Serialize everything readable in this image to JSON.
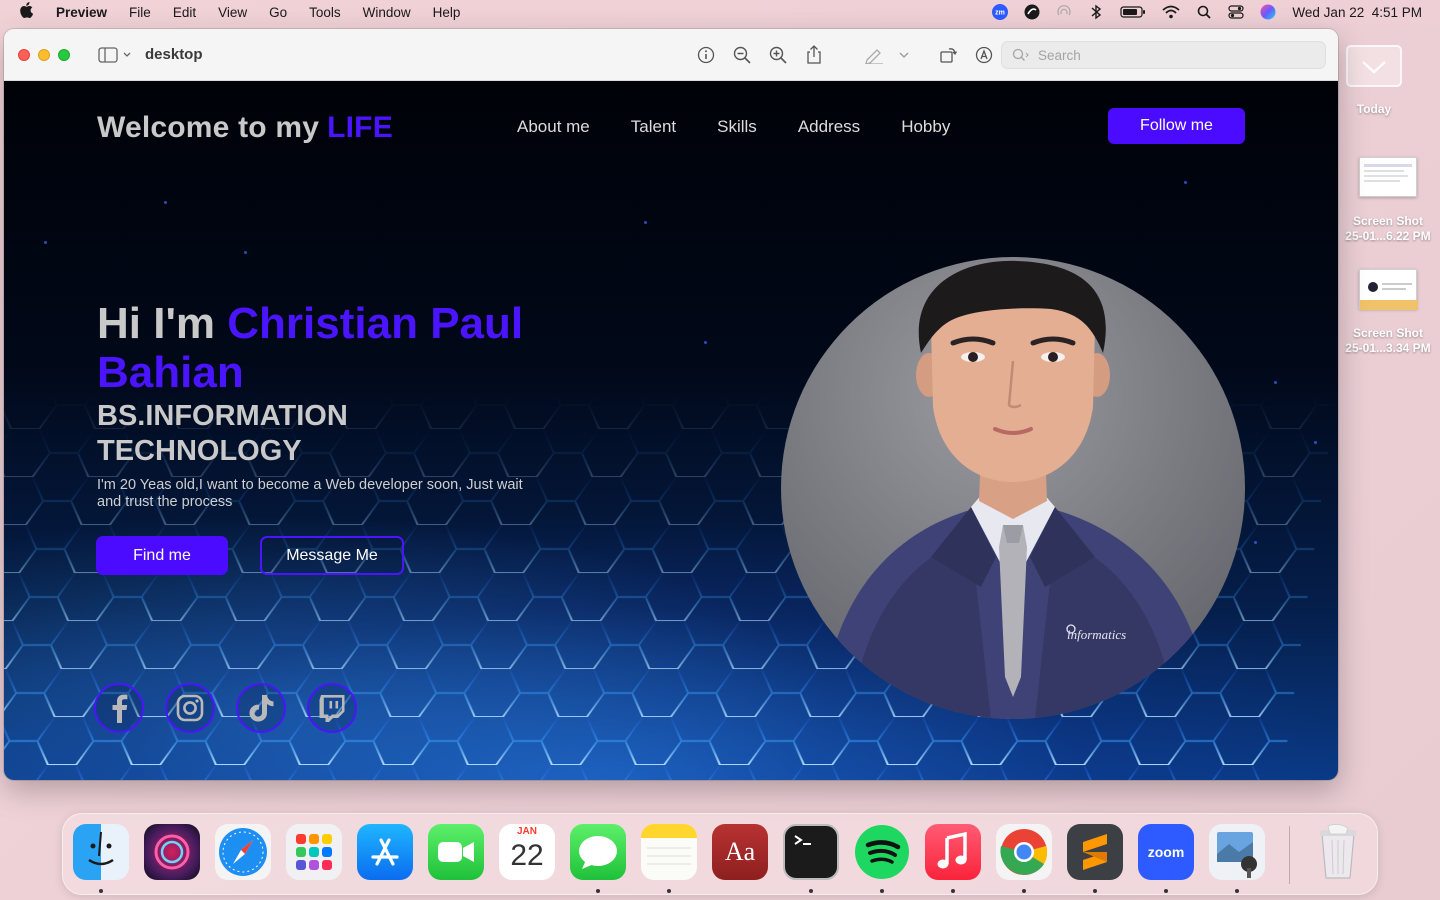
{
  "menubar": {
    "app_name": "Preview",
    "items": [
      "File",
      "Edit",
      "View",
      "Go",
      "Tools",
      "Window",
      "Help"
    ],
    "status_icons": [
      "zoom-icon",
      "creative-cloud-icon",
      "airdrop-icon",
      "bluetooth-icon",
      "battery-icon",
      "wifi-icon",
      "spotlight-icon",
      "control-center-icon",
      "siri-icon"
    ],
    "datetime": "Wed Jan 22  4:51 PM"
  },
  "window": {
    "title": "desktop",
    "search_placeholder": "Search"
  },
  "site": {
    "brand": "Welcome to my",
    "brand_accent": "LIFE",
    "nav": [
      "About me",
      "Talent",
      "Skills",
      "Address",
      "Hobby"
    ],
    "follow_button": "Follow me",
    "greeting": "Hi I'm",
    "name": "Christian Paul Bahian",
    "degree": "BS.INFORMATION TECHNOLOGY",
    "description": "I'm 20 Yeas old,I want to become a Web developer soon, Just wait and trust the process",
    "find_button": "Find me",
    "message_button": "Message Me",
    "socials": [
      "facebook-icon",
      "instagram-icon",
      "tiktok-icon",
      "twitch-icon"
    ],
    "portrait_logo_text": "informatics",
    "accent_color": "#4b14ff"
  },
  "desktop": {
    "today_label": "Today",
    "files": [
      {
        "line1": "Screen Shot",
        "line2": "25-01...6.22 PM"
      },
      {
        "line1": "Screen Shot",
        "line2": "25-01...3.34 PM"
      }
    ]
  },
  "dock": {
    "apps": [
      "Finder",
      "Siri",
      "Safari",
      "Launchpad",
      "App Store",
      "FaceTime",
      "Calendar",
      "Messages",
      "Notes",
      "Dictionary",
      "Terminal",
      "Spotify",
      "Music",
      "Chrome",
      "Sublime Text",
      "Zoom",
      "Preview",
      "Trash"
    ],
    "calendar_month": "JAN",
    "calendar_day": "22",
    "dictionary_label": "Aa",
    "zoom_label": "zoom"
  }
}
